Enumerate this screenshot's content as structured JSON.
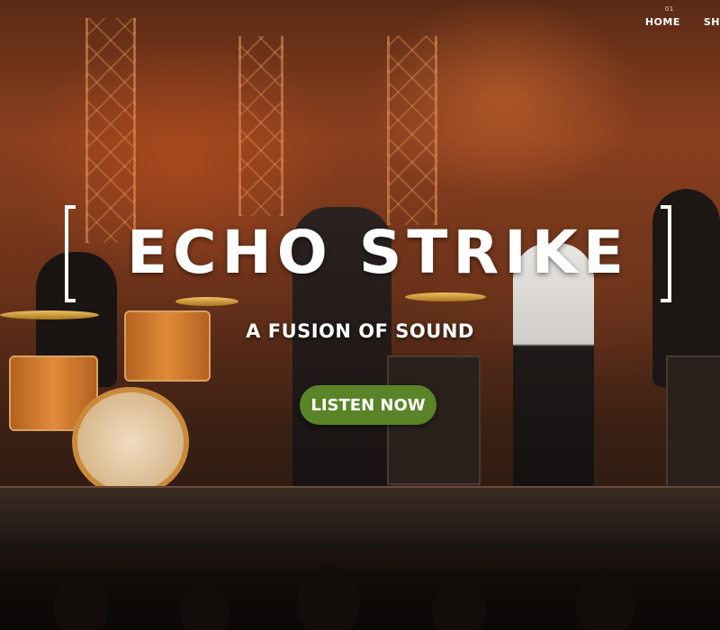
{
  "nav": {
    "items": [
      {
        "number": "01",
        "label": "HOME"
      },
      {
        "label": "SH"
      }
    ]
  },
  "hero": {
    "title": "ECHO STRIKE",
    "tagline": "A FUSION OF SOUND",
    "cta_label": "LISTEN NOW"
  },
  "colors": {
    "accent": "#5a8428",
    "text": "#ffffff"
  }
}
